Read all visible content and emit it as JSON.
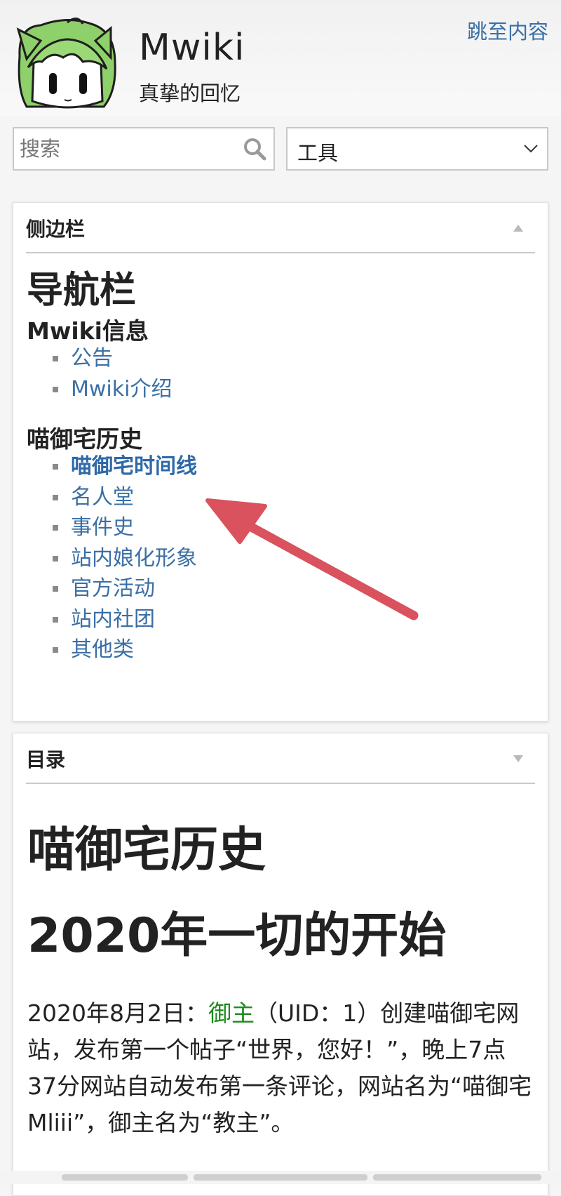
{
  "header": {
    "skip_link": "跳至内容",
    "site_name": "Mwiki",
    "tagline": "真挚的回忆",
    "logo_text": "Mwiki"
  },
  "search": {
    "placeholder": "搜索"
  },
  "tools": {
    "label": "工具"
  },
  "sidebar": {
    "title": "侧边栏",
    "nav_heading": "导航栏",
    "groups": [
      {
        "title": "Mwiki信息",
        "items": [
          "公告",
          "Mwiki介绍"
        ]
      },
      {
        "title": "喵御宅历史",
        "items": [
          "喵御宅时间线",
          "名人堂",
          "事件史",
          "站内娘化形象",
          "官方活动",
          "站内社团",
          "其他类"
        ]
      }
    ],
    "active_item": "喵御宅时间线"
  },
  "toc": {
    "title": "目录",
    "page_title": "喵御宅历史",
    "section_title": "2020年一切的开始",
    "paragraph": {
      "prefix": "2020年8月2日：",
      "user_link": "御主",
      "body": "（UID：1）创建喵御宅网站，发布第一个帖子“世界，您好！”，晚上7点37分网站自动发布第一条评论，网站名为“喵御宅Mliii”，御主名为“教主”。"
    }
  },
  "colors": {
    "link": "#3a6fa6",
    "user_link": "#1e8a1e",
    "annotation_arrow": "#d9525e"
  }
}
